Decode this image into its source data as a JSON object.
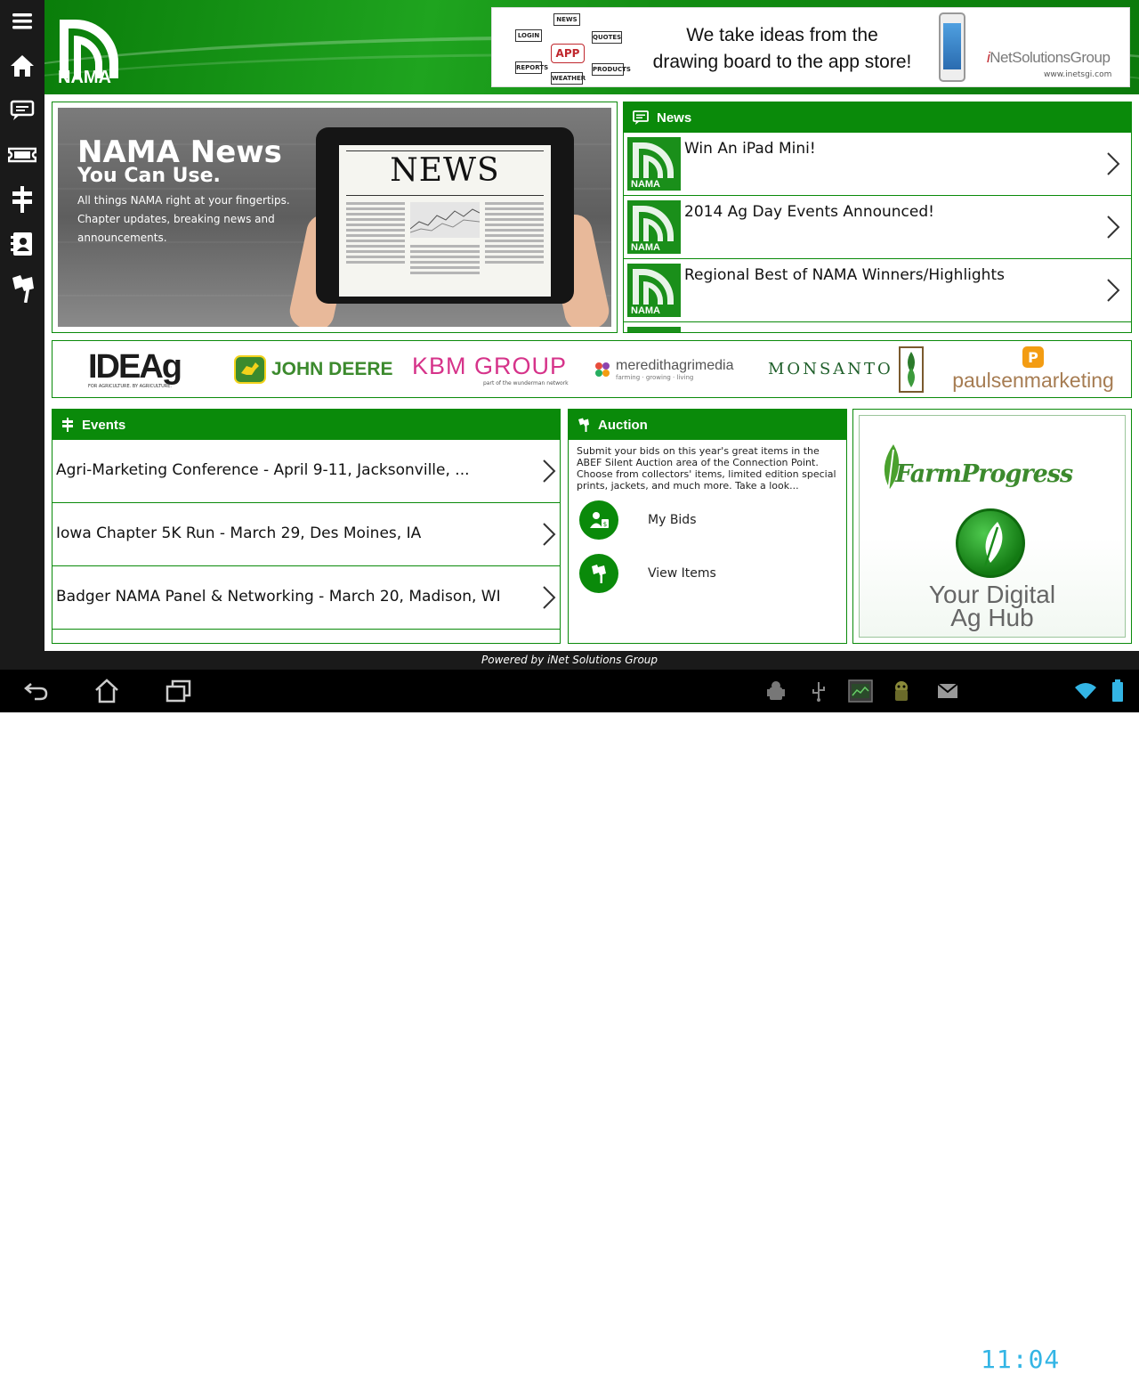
{
  "app": {
    "logo_text": "NAMA",
    "powered_by": "Powered by iNet Solutions Group"
  },
  "rail": {
    "icons": [
      "menu-icon",
      "home-icon",
      "chat-icon",
      "ticket-icon",
      "signpost-icon",
      "contacts-icon",
      "flag-icon"
    ]
  },
  "banner": {
    "headline_line1": "We take ideas from the",
    "headline_line2": "drawing board to the app store!",
    "brand_prefix": "i",
    "brand_rest": "NetSolutionsGroup",
    "url": "www.inetsgi.com",
    "sketch_labels": [
      "NEWS",
      "LOGIN",
      "APP",
      "QUOTES",
      "REPORTS",
      "WEATHER",
      "PRODUCTS"
    ]
  },
  "hero": {
    "title": "NAMA News",
    "subtitle": "You Can Use.",
    "description": "All things NAMA right at your fingertips. Chapter updates, breaking news and announcements.",
    "tablet_headline": "NEWS"
  },
  "news": {
    "header": "News",
    "thumb_label": "NAMA",
    "items": [
      {
        "title": "Win An iPad Mini!"
      },
      {
        "title": "2014 Ag Day Events Announced!"
      },
      {
        "title": "Regional Best of NAMA Winners/Highlights"
      }
    ]
  },
  "sponsors": {
    "items": [
      {
        "name": "IDEAg",
        "tagline": "FOR AGRICULTURE. BY AGRICULTURE."
      },
      {
        "name": "JOHN DEERE"
      },
      {
        "name": "KBM GROUP",
        "tagline": "part of the wunderman network"
      },
      {
        "name": "meredithagrimedia",
        "tagline": "farming · growing · living"
      },
      {
        "name": "MONSANTO"
      },
      {
        "name": "paulsenmarketing"
      }
    ]
  },
  "events": {
    "header": "Events",
    "items": [
      {
        "title": "Agri-Marketing Conference - April 9-11, Jacksonville, ..."
      },
      {
        "title": "Iowa Chapter 5K Run - March 29, Des Moines, IA"
      },
      {
        "title": "Badger NAMA Panel & Networking - March 20, Madison, WI"
      }
    ]
  },
  "auction": {
    "header": "Auction",
    "description": "Submit your bids on this year's great items in the ABEF Silent Auction area of the Connection Point.  Choose from collectors' items, limited edition special prints, jackets, and much more.  Take a look...",
    "my_bids": "My Bids",
    "view_items": "View Items"
  },
  "farm_progress": {
    "name": "FarmProgress",
    "tagline_line1": "Your Digital",
    "tagline_line2": "Ag Hub"
  },
  "status_bar": {
    "time": "11:04",
    "icons": [
      "android-debug-icon",
      "usb-icon",
      "screenshot-icon",
      "android-robot-icon",
      "gmail-icon",
      "wifi-icon",
      "battery-icon"
    ]
  },
  "colors": {
    "brand_green": "#0a8a0a",
    "rail_bg": "#1a1a1a",
    "clock": "#33b5e5"
  }
}
